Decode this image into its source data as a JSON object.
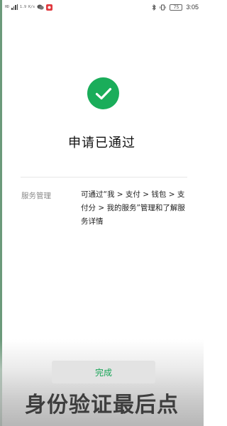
{
  "status_bar": {
    "signal_label": "HD",
    "network_speed": "1.9 K/s",
    "battery": "75",
    "time": "3:05"
  },
  "result": {
    "title": "申请已通过"
  },
  "info": {
    "label": "服务管理",
    "description": "可通过“我 > 支付 > 钱包 > 支付分 > 我的服务”管理和了解服务详情"
  },
  "footer": {
    "done_label": "完成"
  },
  "video_caption": "身份验证最后点",
  "colors": {
    "accent_green": "#1aad5a",
    "button_text_green": "#17a557"
  }
}
